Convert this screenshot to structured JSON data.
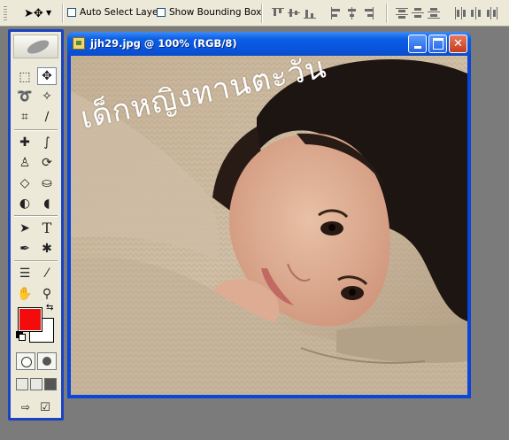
{
  "options_bar": {
    "auto_select_label": "Auto Select Layer",
    "bounding_box_label": "Show Bounding Box",
    "auto_select_checked": false,
    "bounding_box_checked": false
  },
  "document": {
    "title": "jjh29.jpg @ 100% (RGB/8)",
    "overlay_text": "เด็กหญิงทานตะวัน",
    "buttons": {
      "minimize": "_",
      "maximize": "□",
      "close": "✕"
    }
  },
  "toolbox": {
    "foreground_color": "#f40b0b",
    "background_color": "#ffffff",
    "tools": [
      {
        "name": "marquee",
        "glyph": "⬚"
      },
      {
        "name": "move",
        "glyph": "✥"
      },
      {
        "name": "lasso",
        "glyph": "➰"
      },
      {
        "name": "magic-wand",
        "glyph": "✧"
      },
      {
        "name": "crop",
        "glyph": "⌗"
      },
      {
        "name": "slice",
        "glyph": "∕"
      },
      {
        "name": "healing",
        "glyph": "✚"
      },
      {
        "name": "brush",
        "glyph": "∫"
      },
      {
        "name": "stamp",
        "glyph": "♙"
      },
      {
        "name": "history-brush",
        "glyph": "⟳"
      },
      {
        "name": "eraser",
        "glyph": "◇"
      },
      {
        "name": "bucket",
        "glyph": "⛀"
      },
      {
        "name": "blur",
        "glyph": "◐"
      },
      {
        "name": "dodge",
        "glyph": "◖"
      },
      {
        "name": "path-select",
        "glyph": "➤"
      },
      {
        "name": "type",
        "glyph": "T"
      },
      {
        "name": "pen",
        "glyph": "✒"
      },
      {
        "name": "shape",
        "glyph": "✱"
      },
      {
        "name": "notes",
        "glyph": "☰"
      },
      {
        "name": "eyedropper",
        "glyph": "⁄"
      },
      {
        "name": "hand",
        "glyph": "✋"
      },
      {
        "name": "zoom",
        "glyph": "⚲"
      }
    ]
  },
  "colors": {
    "titlebar": "#0a5fe5",
    "toolbox_frame": "#1a44c2",
    "workspace": "#7b7b7b"
  }
}
